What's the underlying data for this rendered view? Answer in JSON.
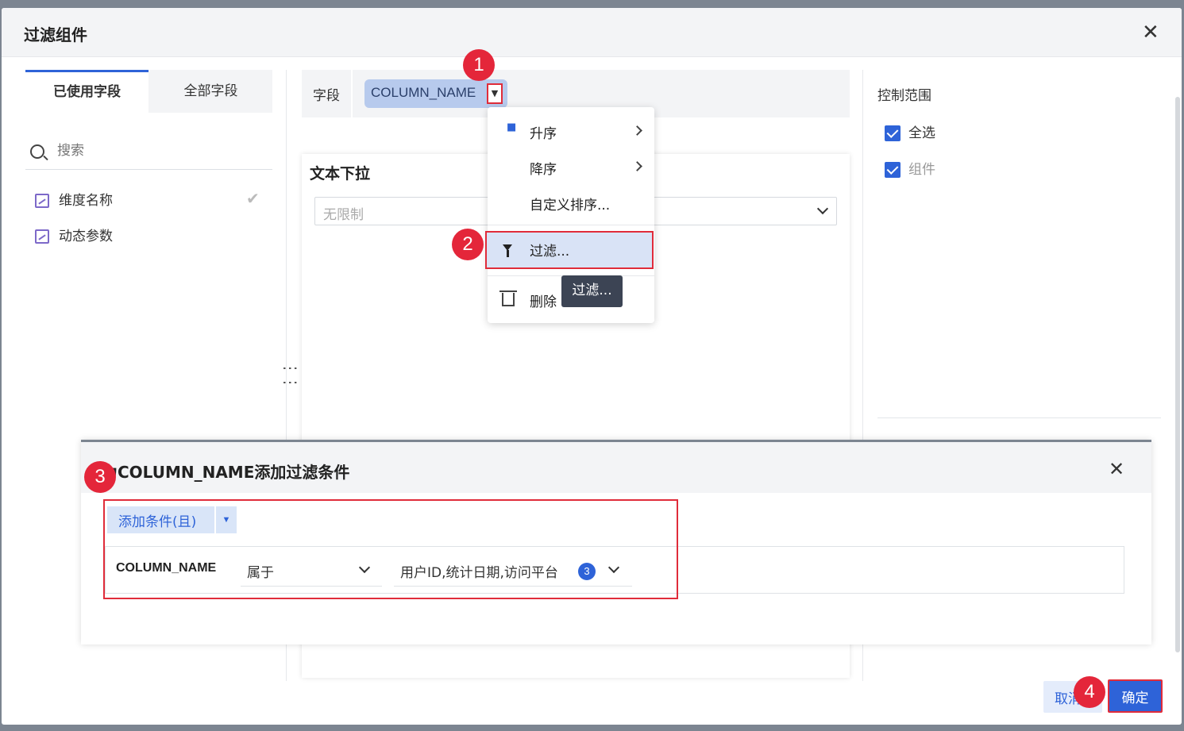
{
  "dialog": {
    "title": "过滤组件"
  },
  "left_panel": {
    "tabs": [
      {
        "label": "已使用字段",
        "active": true
      },
      {
        "label": "全部字段",
        "active": false
      }
    ],
    "search_placeholder": "搜索",
    "fields": [
      {
        "label": "维度名称",
        "checked": true
      },
      {
        "label": "动态参数",
        "checked": false
      }
    ]
  },
  "field_bar": {
    "label": "字段",
    "chip": "COLUMN_NAME"
  },
  "preview": {
    "title": "文本下拉",
    "select_placeholder": "无限制"
  },
  "menu": {
    "items": [
      {
        "label": "升序",
        "has_submenu": true
      },
      {
        "label": "降序",
        "has_submenu": true
      },
      {
        "label": "自定义排序..."
      },
      {
        "label": "过滤..."
      },
      {
        "label": "删除"
      }
    ],
    "tooltip": "过滤..."
  },
  "right_panel": {
    "title": "控制范围",
    "checkboxes": [
      {
        "label": "全选",
        "checked": true
      },
      {
        "label": "组件",
        "checked": true
      }
    ]
  },
  "filter_dialog": {
    "title": "为COLUMN_NAME添加过滤条件",
    "add_button": "添加条件(且)",
    "condition": {
      "field": "COLUMN_NAME",
      "operator": "属于",
      "values": "用户ID,统计日期,访问平台",
      "count": "3"
    }
  },
  "buttons": {
    "cancel": "取消",
    "ok": "确定"
  },
  "steps": [
    "1",
    "2",
    "3",
    "4"
  ],
  "colors": {
    "accent": "#2e63d8",
    "highlight": "#e02c3a",
    "badge": "#e4263a"
  }
}
